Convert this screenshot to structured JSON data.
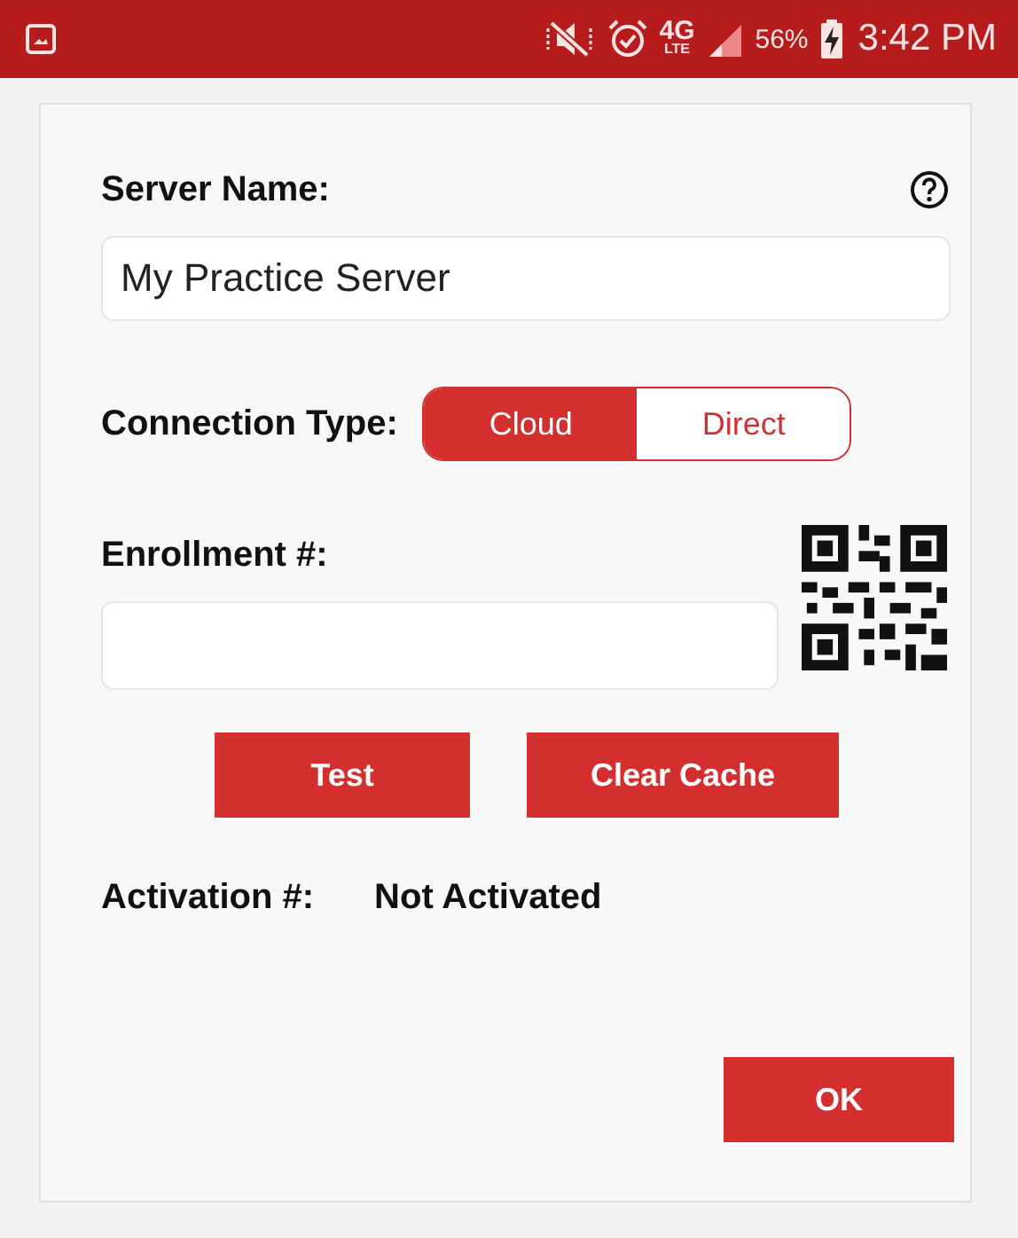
{
  "status_bar": {
    "network": "4G",
    "network_sub": "LTE",
    "battery": "56%",
    "time": "3:42 PM"
  },
  "dialog": {
    "server_name": {
      "label": "Server Name:",
      "value": "My Practice Server"
    },
    "connection_type": {
      "label": "Connection Type:",
      "options": [
        {
          "label": "Cloud",
          "selected": true
        },
        {
          "label": "Direct",
          "selected": false
        }
      ]
    },
    "enrollment": {
      "label": "Enrollment #:"
    },
    "actions": [
      "Test",
      "Clear Cache"
    ],
    "activation": {
      "label": "Activation #:",
      "value": "Not Activated"
    },
    "ok": "OK"
  }
}
